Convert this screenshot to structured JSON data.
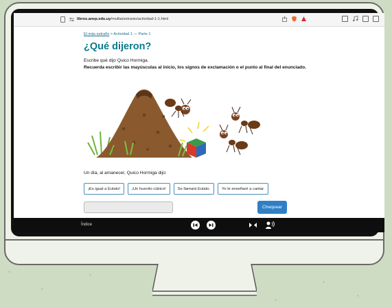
{
  "browser": {
    "url_domain": "libros.anep.edu.uy",
    "url_path": "/multia/extranio/actividad-1-1.html"
  },
  "page": {
    "breadcrumb_link": "El más extraño",
    "breadcrumb_rest": " > Actividad 1 — Parte 1",
    "title": "¿Qué dijeron?",
    "instruction_1": "Escribe qué dijo Quico Hormiga.",
    "instruction_2": "Recuerda escribir las mayúsculas al inicio, los signos de exclamación o el punto al final del enunciado.",
    "prompt": "Un día, al amanecer, Quico Hormiga dijo:",
    "options": [
      "¡Es igual a Eulato!",
      "¡Un huevito cúbico!",
      "Se llamará Eulato.",
      "Yo le enseñaré a cantar."
    ],
    "answer_value": "",
    "check_label": "Chequear"
  },
  "bottom_bar": {
    "index_label": "Índice",
    "icons": [
      "previous-icon",
      "next-icon",
      "fullscreen-icon",
      "read-aloud-icon"
    ]
  },
  "colors": {
    "title": "#0a7a8c",
    "check_button": "#2f7fc6",
    "option_border": "#4a8fb0",
    "background": "#cfdcc4"
  }
}
